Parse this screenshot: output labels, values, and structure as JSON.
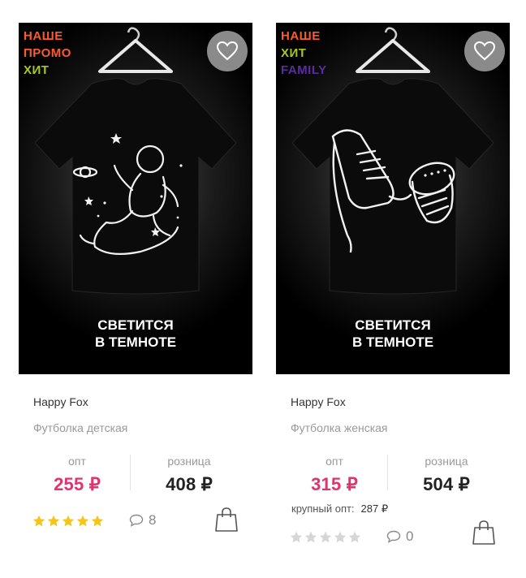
{
  "products": [
    {
      "badges": [
        {
          "text": "НАШЕ",
          "color": "#ff5a2a"
        },
        {
          "text": "ПРОМО",
          "color": "#ff5a2a"
        },
        {
          "text": "ХИТ",
          "color": "#a6c81e"
        }
      ],
      "print_text_line1": "СВЕТИТСЯ",
      "print_text_line2": "В ТЕМНОТЕ",
      "print_motif": "astronaut",
      "brand": "Happy Fox",
      "product_type": "Футболка детская",
      "opt_label": "опт",
      "opt_price": "255 ₽",
      "retail_label": "розница",
      "retail_price": "408 ₽",
      "rating": 5,
      "comments_count": "8"
    },
    {
      "badges": [
        {
          "text": "НАШЕ",
          "color": "#ff5a2a"
        },
        {
          "text": "ХИТ",
          "color": "#a6c81e"
        },
        {
          "text": "FAMILY",
          "color": "#5b2ca0"
        }
      ],
      "print_text_line1": "СВЕТИТСЯ",
      "print_text_line2": "В ТЕМНОТЕ",
      "print_motif": "sneakers",
      "brand": "Happy Fox",
      "product_type": "Футболка женская",
      "opt_label": "опт",
      "opt_price": "315 ₽",
      "retail_label": "розница",
      "retail_price": "504 ₽",
      "bulk_label": "крупный опт:",
      "bulk_price": "287 ₽",
      "rating": 0,
      "comments_count": "0"
    }
  ],
  "colors": {
    "opt_price": "#e0336f",
    "star_active": "#f5c518",
    "star_inactive": "#d6d6d6",
    "fav_button": "#8a8a8a"
  },
  "icons": {
    "favorite": "heart-outline-icon",
    "comments": "speech-bubble-icon",
    "cart": "shopping-bag-icon",
    "rating": "star-icon"
  }
}
